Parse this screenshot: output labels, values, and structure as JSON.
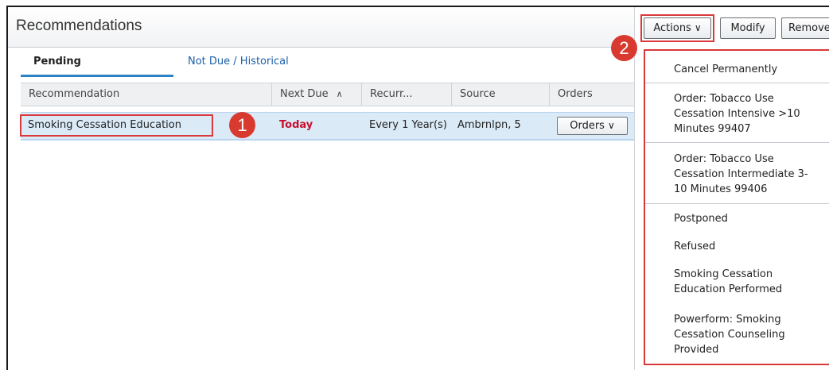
{
  "panel": {
    "title": "Recommendations"
  },
  "tabs": [
    {
      "label": "Pending",
      "active": true
    },
    {
      "label": "Not Due / Historical",
      "active": false
    }
  ],
  "table": {
    "columns": [
      "Recommendation",
      "Next Due",
      "Recurr...",
      "Source",
      "Orders"
    ],
    "sort_column": "Next Due",
    "sort_icon": "chevron-up-icon",
    "rows": [
      {
        "recommendation": "Smoking Cessation Education",
        "next_due": "Today",
        "recurrence": "Every 1 Year(s)",
        "source": "Ambrnlpn, 5",
        "orders_button": "Orders"
      }
    ]
  },
  "toolbar": {
    "actions_label": "Actions",
    "modify_label": "Modify",
    "remove_label": "Remove"
  },
  "callouts": [
    "1",
    "2"
  ],
  "actions_menu": [
    "Cancel Permanently",
    "Order: Tobacco Use Cessation Intensive >10 Minutes 99407",
    "Order: Tobacco Use Cessation Intermediate 3-10 Minutes 99406",
    "Postponed",
    "Refused",
    "Smoking Cessation Education Performed",
    "Powerform: Smoking Cessation Counseling Provided"
  ],
  "colors": {
    "highlight_red": "#d9393a",
    "due_today": "#c8102e",
    "tab_accent": "#2b83c6",
    "selected_row": "#dbeaf7"
  }
}
